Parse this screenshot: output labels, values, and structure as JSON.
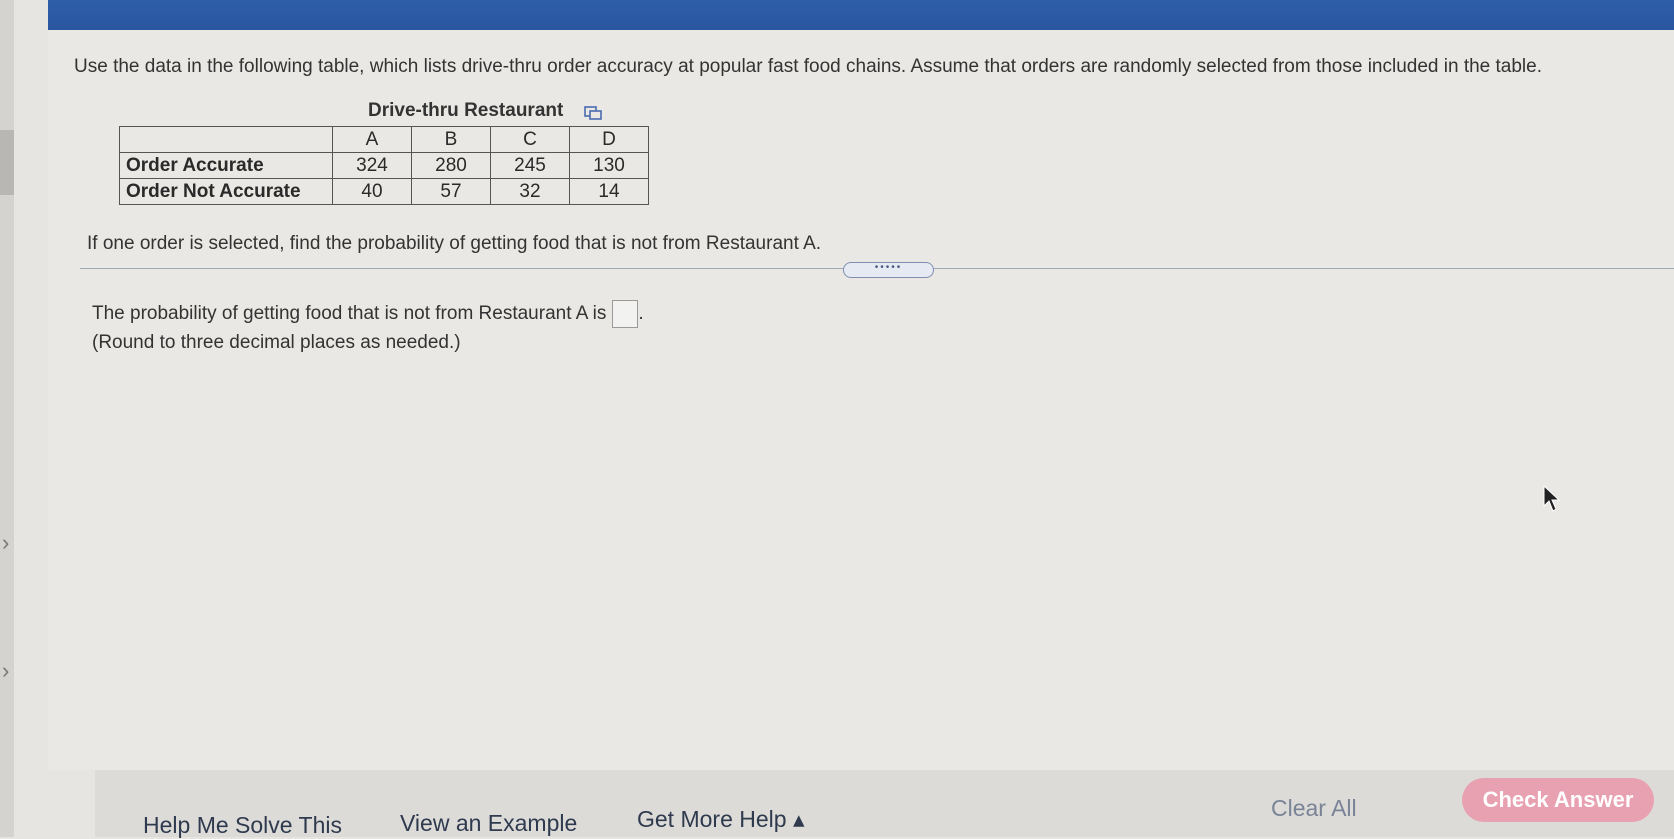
{
  "instructions": "Use the data in the following table, which lists drive-thru order accuracy at popular fast food chains. Assume that orders are randomly selected from those included in the table.",
  "table": {
    "caption": "Drive-thru Restaurant",
    "columns": [
      "A",
      "B",
      "C",
      "D"
    ],
    "rows": [
      {
        "label": "Order Accurate",
        "values": [
          "324",
          "280",
          "245",
          "130"
        ]
      },
      {
        "label": "Order Not Accurate",
        "values": [
          "40",
          "57",
          "32",
          "14"
        ]
      }
    ]
  },
  "question": "If one order is selected, find the probability of getting food that is not from Restaurant A.",
  "answer": {
    "prompt": "The probability of getting food that is not from Restaurant A is",
    "suffix": ".",
    "value": "",
    "note": "(Round to three decimal places as needed.)"
  },
  "divider_handle": "•••••",
  "footer": {
    "help_me_solve": "Help Me Solve This",
    "view_example": "View an Example",
    "get_more_help": "Get More Help ▴",
    "clear_all": "Clear All",
    "check_answer": "Check Answer"
  },
  "rail": {
    "chevron": "›"
  },
  "colors": {
    "header_blue": "#2a56a0",
    "check_answer_bg": "#e8a1b0"
  }
}
